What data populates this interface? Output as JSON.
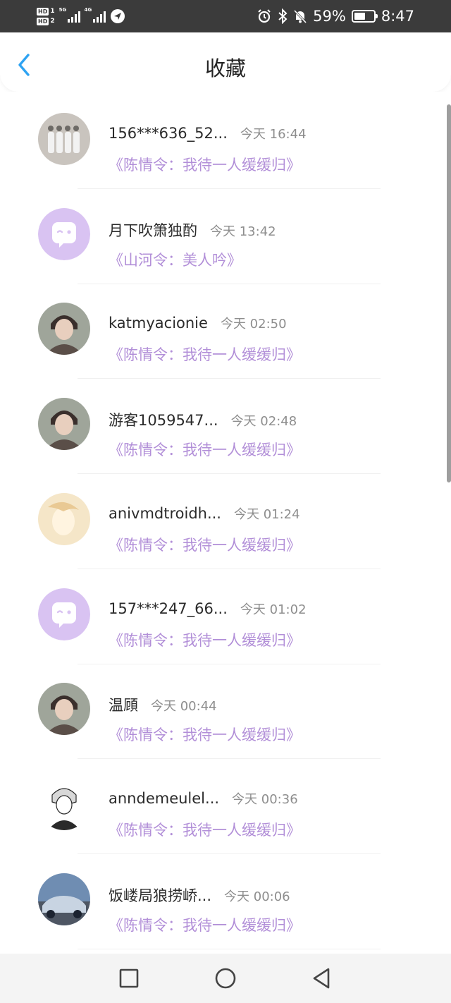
{
  "status_bar": {
    "hd1": "HD",
    "hd1_num": "1",
    "hd2": "HD",
    "hd2_num": "2",
    "net1": "5G",
    "net2": "4G",
    "battery_percent": "59%",
    "battery_level": 0.59,
    "time": "8:47",
    "icons": [
      "alarm-icon",
      "bluetooth-icon",
      "mute-icon",
      "battery-icon"
    ]
  },
  "header": {
    "title": "收藏",
    "back_icon": "chevron-left-icon",
    "accent_color": "#2ea3f2"
  },
  "list": [
    {
      "name": "156***636_52...",
      "time": "今天 16:44",
      "work": "《陈情令：我待一人缓缓归》",
      "avatar": "group-photo"
    },
    {
      "name": "月下吹箫独酌",
      "time": "今天 13:42",
      "work": "《山河令：美人吟》",
      "avatar": "default-bubble"
    },
    {
      "name": "katmyacionie",
      "time": "今天 02:50",
      "work": "《陈情令：我待一人缓缓归》",
      "avatar": "portrait"
    },
    {
      "name": "游客1059547...",
      "time": "今天 02:48",
      "work": "《陈情令：我待一人缓缓归》",
      "avatar": "portrait"
    },
    {
      "name": "anivmdtroidh...",
      "time": "今天 01:24",
      "work": "《陈情令：我待一人缓缓归》",
      "avatar": "light-portrait"
    },
    {
      "name": "157***247_66...",
      "time": "今天 01:02",
      "work": "《陈情令：我待一人缓缓归》",
      "avatar": "default-bubble"
    },
    {
      "name": "温頋",
      "time": "今天 00:44",
      "work": "《陈情令：我待一人缓缓归》",
      "avatar": "portrait"
    },
    {
      "name": "anndemeulel...",
      "time": "今天 00:36",
      "work": "《陈情令：我待一人缓缓归》",
      "avatar": "sketch"
    },
    {
      "name": "饭嵝局狼捞峤...",
      "time": "今天 00:06",
      "work": "《陈情令：我待一人缓缓归》",
      "avatar": "car"
    }
  ],
  "colors": {
    "work_title": "#b28fd8",
    "default_avatar_bg": "#d9c3f2",
    "status_bar_bg": "#3b3b3b"
  },
  "nav": {
    "icons": [
      "recents-square-icon",
      "home-circle-icon",
      "back-triangle-icon"
    ]
  }
}
